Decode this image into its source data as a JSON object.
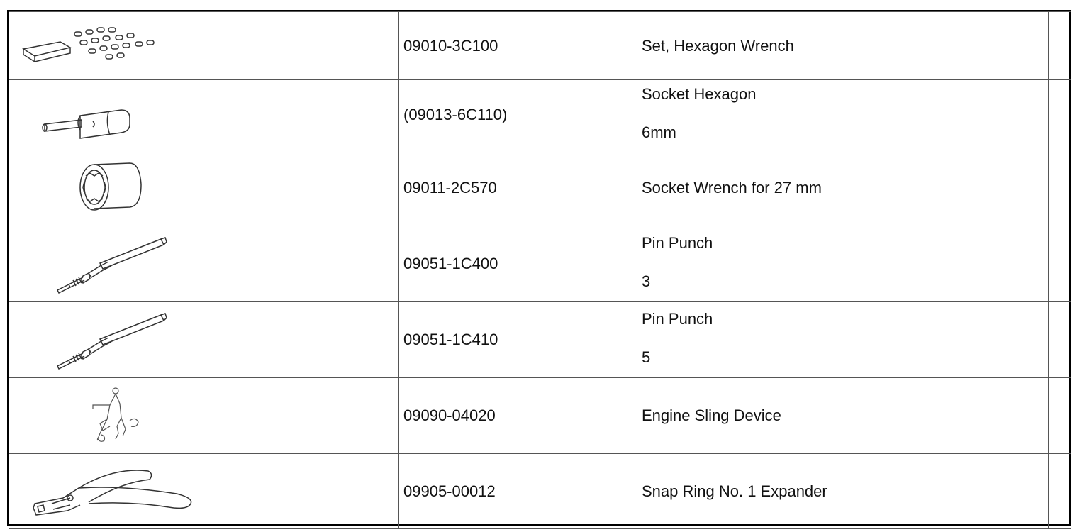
{
  "tools": [
    {
      "icon": "hexagon-wrench-set-icon",
      "part_number": "09010-3C100",
      "name": "Set, Hexagon Wrench",
      "size": ""
    },
    {
      "icon": "socket-hexagon-icon",
      "part_number": "(09013-6C110)",
      "name": "Socket Hexagon",
      "size": "6mm"
    },
    {
      "icon": "socket-wrench-icon",
      "part_number": "09011-2C570",
      "name": "Socket Wrench for 27 mm",
      "size": ""
    },
    {
      "icon": "pin-punch-icon",
      "part_number": "09051-1C400",
      "name": "Pin Punch",
      "size": "3"
    },
    {
      "icon": "pin-punch-icon",
      "part_number": "09051-1C410",
      "name": "Pin Punch",
      "size": "5"
    },
    {
      "icon": "engine-sling-device-icon",
      "part_number": "09090-04020",
      "name": "Engine Sling Device",
      "size": ""
    },
    {
      "icon": "snap-ring-expander-icon",
      "part_number": "09905-00012",
      "name": "Snap Ring No. 1 Expander",
      "size": ""
    }
  ]
}
